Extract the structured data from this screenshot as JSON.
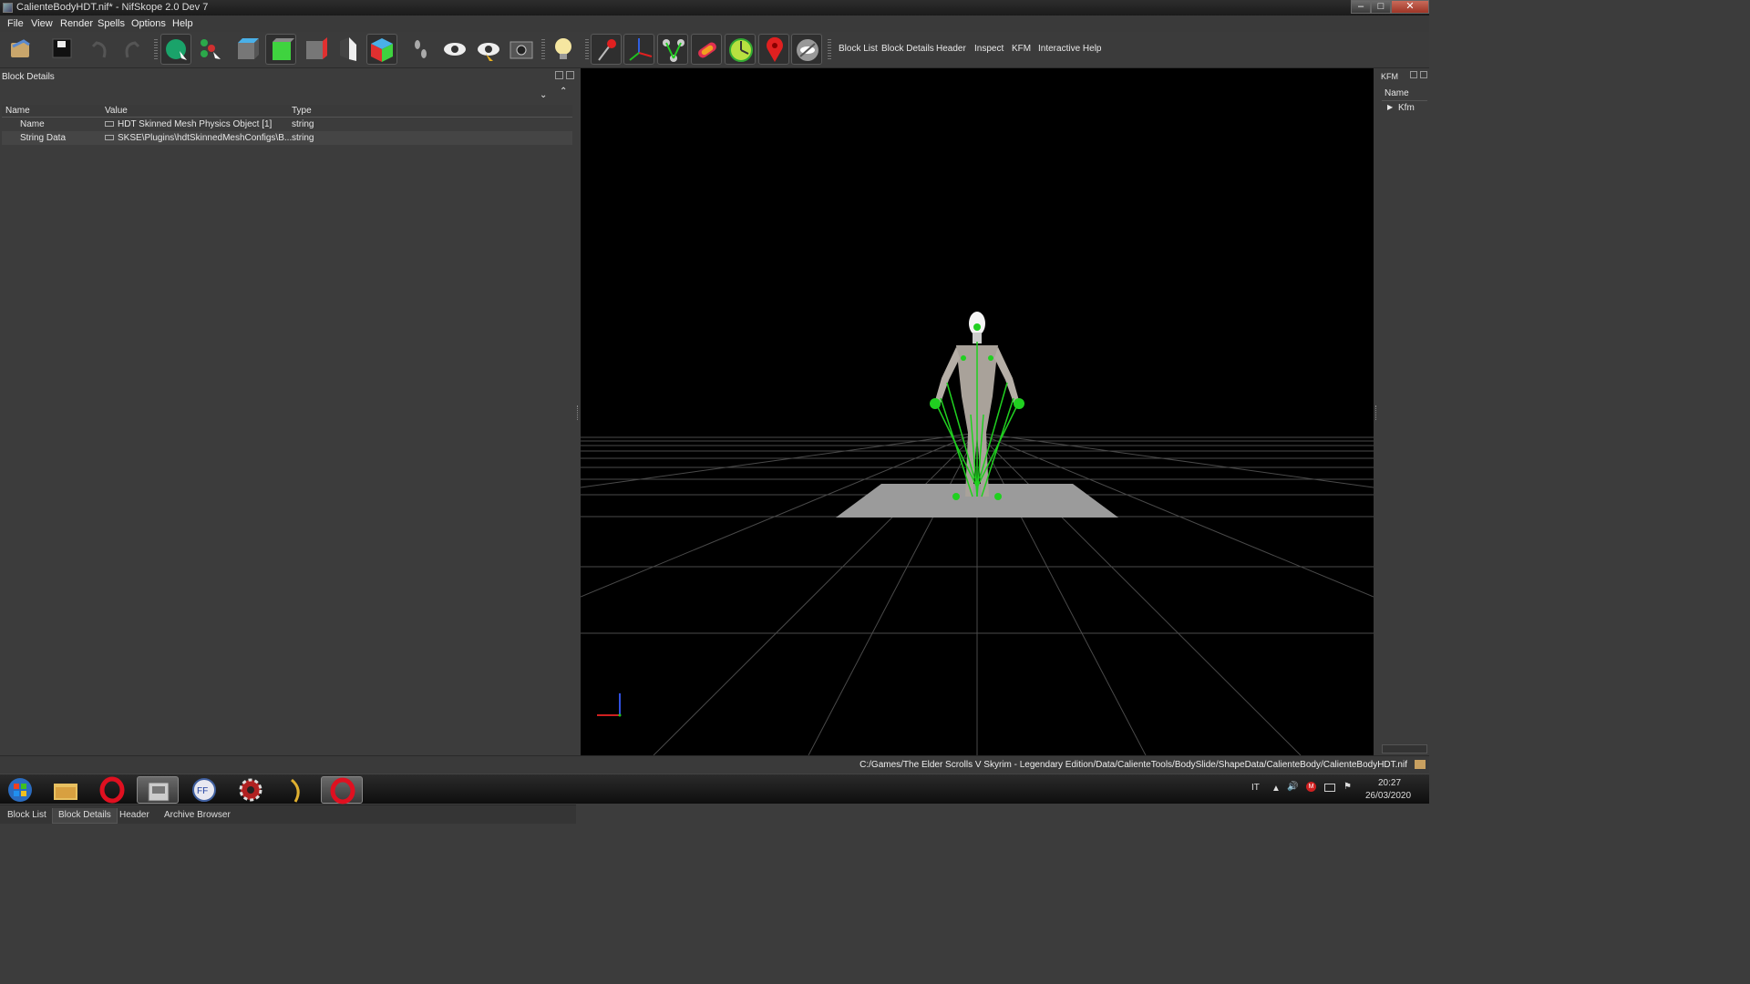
{
  "window": {
    "title": "CalienteBodyHDT.nif* - NifSkope 2.0 Dev 7"
  },
  "menu": [
    "File",
    "View",
    "Render",
    "Spells",
    "Options",
    "Help"
  ],
  "toolbar": {
    "icons": [
      "load-icon",
      "save-icon",
      "undo-icon",
      "redo-icon",
      "select-object-icon",
      "select-vertex-icon",
      "view-top-icon",
      "view-front-icon",
      "view-side-icon",
      "view-flip-icon",
      "view-user-icon",
      "walk-mode-icon",
      "show-hidden-icon",
      "show-selected-icon",
      "screenshot-icon",
      "lighting-icon",
      "show-markers-icon",
      "show-axes-icon",
      "show-nodes-icon",
      "show-collision-icon",
      "show-constraints-icon",
      "show-furniture-icon",
      "show-hidden-eye-icon"
    ],
    "text_buttons": [
      "Block List",
      "Block Details",
      "Header",
      "Inspect",
      "KFM",
      "Interactive Help"
    ]
  },
  "block_details": {
    "panel_title": "Block Details",
    "columns": [
      "Name",
      "Value",
      "Type"
    ],
    "rows": [
      {
        "name": "Name",
        "value": "HDT Skinned Mesh Physics Object [1]",
        "type": "string"
      },
      {
        "name": "String Data",
        "value": "SKSE\\Plugins\\hdtSkinnedMeshConfigs\\B...",
        "type": "string"
      }
    ]
  },
  "left_tabs": [
    "Block List",
    "Block Details",
    "Header",
    "Archive Browser"
  ],
  "active_left_tab": "Block Details",
  "kfm_panel": {
    "title": "KFM",
    "column": "Name",
    "items": [
      "Kfm"
    ]
  },
  "status": {
    "path": "C:/Games/The Elder Scrolls V Skyrim - Legendary Edition/Data/CalienteTools/BodySlide/ShapeData/CalienteBody/CalienteBodyHDT.nif"
  },
  "taskbar": {
    "apps": [
      "start-orb-icon",
      "explorer-icon",
      "opera-icon",
      "nifskope-icon",
      "ffdec-icon",
      "gear-app-icon",
      "bodyslide-icon",
      "opera-red-icon"
    ],
    "language": "IT",
    "time": "20:27",
    "date": "26/03/2020"
  },
  "colors": {
    "bone_green": "#20d020",
    "background_dark": "#3c3c3c",
    "viewport": "#000000"
  }
}
